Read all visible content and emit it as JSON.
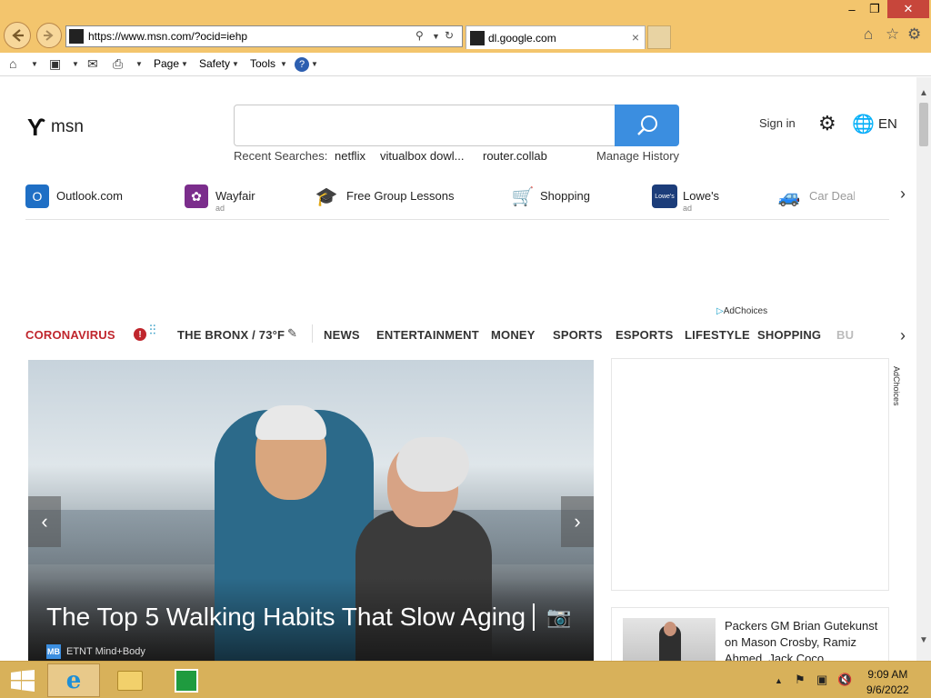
{
  "browser": {
    "url": "https://www.msn.com/?ocid=iehp",
    "tab_label": "dl.google.com",
    "window_buttons": {
      "minimize": "–",
      "restore": "❐",
      "close": "✕"
    },
    "command_bar": {
      "page": "Page",
      "safety": "Safety",
      "tools": "Tools"
    }
  },
  "msn": {
    "logo_text": "msn",
    "recent_label": "Recent Searches:",
    "recent_searches": [
      "netflix",
      "vitualbox dowl...",
      "router.collab"
    ],
    "manage_history": "Manage History",
    "sign_in": "Sign in",
    "language": "EN",
    "quick_links": [
      {
        "label": "Outlook.com",
        "ad": "",
        "icon": "outlook-icon"
      },
      {
        "label": "Wayfair",
        "ad": "ad",
        "icon": "wayfair-icon"
      },
      {
        "label": "Free Group Lessons",
        "ad": "",
        "icon": "graduation-cap-icon"
      },
      {
        "label": "Shopping",
        "ad": "",
        "icon": "shopping-cart-icon"
      },
      {
        "label": "Lowe's",
        "ad": "ad",
        "icon": "lowes-icon"
      },
      {
        "label": "Car Deal",
        "ad": "",
        "icon": "car-icon"
      }
    ],
    "ad_choices": "AdChoices",
    "nav": {
      "coronavirus": "CORONAVIRUS",
      "weather": "THE BRONX / 73°F",
      "items": [
        "NEWS",
        "ENTERTAINMENT",
        "MONEY",
        "SPORTS",
        "ESPORTS",
        "LIFESTYLE",
        "SHOPPING",
        "BU"
      ]
    },
    "hero": {
      "headline": "The Top 5 Walking Habits That Slow Aging",
      "source_badge": "MB",
      "source": "ETNT Mind+Body"
    },
    "side_card": {
      "title": "Packers GM Brian Gutekunst on Mason Crosby, Ramiz Ahmed, Jack Coco"
    }
  },
  "taskbar": {
    "time": "9:09 AM",
    "date": "9/6/2022"
  },
  "colors": {
    "titlebar": "#f3c56d",
    "taskbar": "#d8b15a",
    "search_blue": "#3b8ee0",
    "coronavirus_red": "#c0262d"
  }
}
